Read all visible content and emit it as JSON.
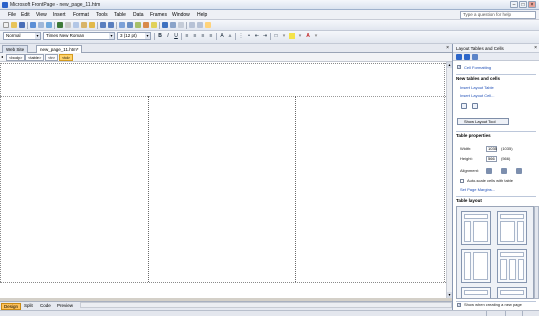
{
  "window": {
    "title": "Microsoft FrontPage - new_page_11.htm",
    "minimize_icon": "minimize-icon",
    "maximize_icon": "maximize-icon",
    "close_icon": "close-icon"
  },
  "menu": {
    "items": [
      "File",
      "Edit",
      "View",
      "Insert",
      "Format",
      "Tools",
      "Table",
      "Data",
      "Frames",
      "Window",
      "Help"
    ],
    "help_placeholder": "Type a question for help"
  },
  "formatting": {
    "style": "Normal",
    "font": "Times New Roman",
    "size": "3 (12 pt)",
    "bold": "B",
    "italic": "I",
    "underline": "U"
  },
  "editor": {
    "tabs": [
      "Web Site",
      "new_page_11.htm*"
    ],
    "tag_selector": [
      "<body>",
      "<table>",
      "<tr>",
      "<td>"
    ],
    "view_tabs": [
      "Design",
      "Split",
      "Code",
      "Preview"
    ]
  },
  "taskpane": {
    "title": "Layout Tables and Cells",
    "cell_formatting": "Cell Formatting",
    "new_tables_heading": "New tables and cells",
    "insert_layout_table": "Insert Layout Table",
    "insert_layout_cell": "Insert Layout Cell...",
    "show_layout_tool": "Show Layout Tool",
    "table_properties_heading": "Table properties",
    "width_label": "Width:",
    "width_value": "1035",
    "width_actual": "(1035)",
    "height_label": "Height:",
    "height_value": "566",
    "height_actual": "(566)",
    "alignment_label": "Alignment:",
    "autoscale_label": "Auto-scale cells with table",
    "set_page_margins": "Set Page Margins...",
    "table_layout_heading": "Table layout",
    "show_when_creating": "Show when creating a new page"
  }
}
